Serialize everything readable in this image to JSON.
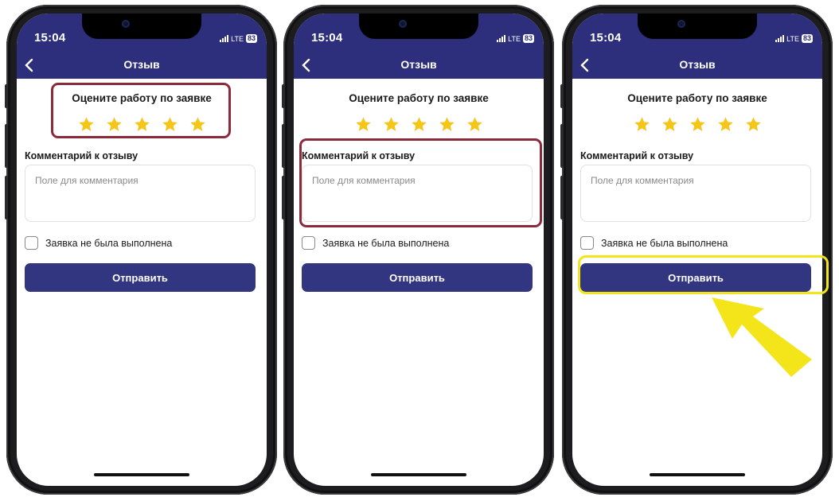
{
  "status_bar": {
    "time": "15:04",
    "network": "LTE",
    "battery": "83"
  },
  "nav": {
    "title": "Отзыв",
    "back_icon": "chevron-left-icon"
  },
  "form": {
    "rating_title": "Оцените работу по заявке",
    "rating_value": 5,
    "rating_max": 5,
    "comment_label": "Комментарий к отзыву",
    "comment_placeholder": "Поле для комментария",
    "checkbox_label": "Заявка не была выполнена",
    "checkbox_checked": false,
    "submit_label": "Отправить"
  },
  "phones": [
    {
      "highlight": "rating"
    },
    {
      "highlight": "comment"
    },
    {
      "highlight": "submit"
    }
  ],
  "colors": {
    "header": "#2d2f7c",
    "button": "#32357f",
    "star": "#f5c518",
    "highlight_red": "#8b2a3b",
    "highlight_yellow": "#f4e51b",
    "arrow": "#f4e51b"
  }
}
